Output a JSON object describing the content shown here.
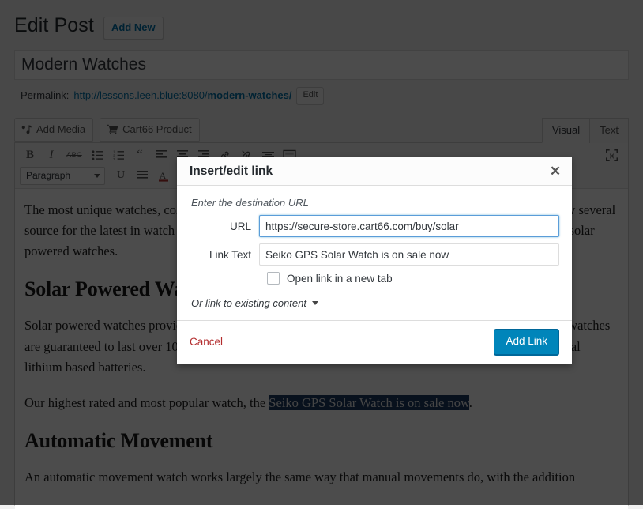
{
  "header": {
    "title": "Edit Post",
    "add_new_label": "Add New"
  },
  "post": {
    "title_value": "Modern Watches",
    "permalink_label": "Permalink:",
    "permalink_base": "http://lessons.leeh.blue:8080/",
    "permalink_slug": "modern-watches/",
    "edit_slug_label": "Edit"
  },
  "media_row": {
    "add_media_label": "Add Media",
    "cart66_label": "Cart66 Product"
  },
  "editor_tabs": [
    {
      "label": "Visual",
      "active": true
    },
    {
      "label": "Text",
      "active": false
    }
  ],
  "toolbar": {
    "row1": [
      {
        "name": "bold-icon",
        "glyph": "B"
      },
      {
        "name": "italic-icon",
        "glyph": "I"
      },
      {
        "name": "strikethrough-icon",
        "glyph": "ABC"
      },
      {
        "name": "bulleted-list-icon",
        "glyph": "list-ul"
      },
      {
        "name": "numbered-list-icon",
        "glyph": "list-ol"
      },
      {
        "name": "blockquote-icon",
        "glyph": "“"
      },
      {
        "name": "align-left-icon",
        "glyph": "align-left"
      },
      {
        "name": "align-center-icon",
        "glyph": "align-center"
      },
      {
        "name": "align-right-icon",
        "glyph": "align-right"
      },
      {
        "name": "insert-link-icon",
        "glyph": "link"
      },
      {
        "name": "unlink-icon",
        "glyph": "unlink"
      },
      {
        "name": "read-more-icon",
        "glyph": "more"
      },
      {
        "name": "toolbar-toggle-icon",
        "glyph": "kitchen-sink"
      }
    ],
    "row2": [
      {
        "name": "underline-icon",
        "glyph": "U"
      },
      {
        "name": "justify-icon",
        "glyph": "align-justify"
      },
      {
        "name": "text-color-icon",
        "glyph": "A"
      }
    ],
    "format_select_value": "Paragraph",
    "fullscreen_label": "Distraction-free writing mode"
  },
  "content": {
    "paragraph1": "The most unique watches, collected from watchmakers and enthusiasts all around the world! We'll review several source for the latest in watch movement technology including quartz movement, automatic watches and solar powered watches.",
    "heading1": "Solar Powered Watches",
    "paragraph2_before": "Solar powered watches provide accurate timekeeping for years without a battery change. Many of these watches are guaranteed to last over 10 years. Solar batteries provide just as much power and accuracy as traditional lithium based batteries.",
    "paragraph3_prefix": "Our highest rated and most popular watch, the ",
    "paragraph3_selected": "Seiko GPS Solar Watch is on sale now",
    "paragraph3_suffix": ".",
    "heading2": "Automatic Movement",
    "paragraph4": "An automatic movement watch works largely the same way that manual movements do, with the addition"
  },
  "modal": {
    "title": "Insert/edit link",
    "close_glyph": "✕",
    "hint": "Enter the destination URL",
    "url_label": "URL",
    "url_value": "https://secure-store.cart66.com/buy/solar",
    "url_placeholder": "https://",
    "link_text_label": "Link Text",
    "link_text_value": "Seiko GPS Solar Watch is on sale now",
    "link_text_placeholder": "",
    "new_tab_label": "Open link in a new tab",
    "new_tab_checked": false,
    "existing_content_label": "Or link to existing content",
    "cancel_label": "Cancel",
    "submit_label": "Add Link"
  },
  "colors": {
    "accent_blue": "#0085ba",
    "link_blue": "#0073aa",
    "cancel_red": "#b32d2e",
    "selection_navy": "#1c3a63",
    "focus_border": "#5b9dd9"
  }
}
